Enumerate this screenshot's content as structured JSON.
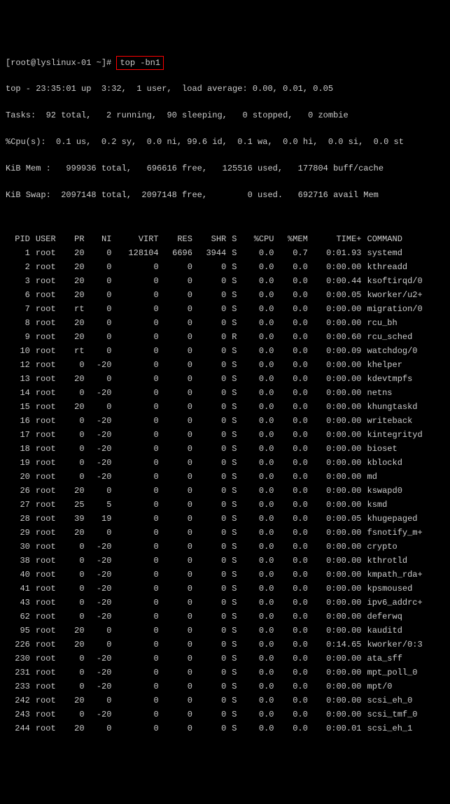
{
  "prompt": {
    "userhost": "[root@lyslinux-01 ~]#",
    "command": "top -bn1"
  },
  "summary": {
    "line1": "top - 23:35:01 up  3:32,  1 user,  load average: 0.00, 0.01, 0.05",
    "line2": "Tasks:  92 total,   2 running,  90 sleeping,   0 stopped,   0 zombie",
    "line3": "%Cpu(s):  0.1 us,  0.2 sy,  0.0 ni, 99.6 id,  0.1 wa,  0.0 hi,  0.0 si,  0.0 st",
    "line4": "KiB Mem :   999936 total,   696616 free,   125516 used,   177804 buff/cache",
    "line5": "KiB Swap:  2097148 total,  2097148 free,        0 used.   692716 avail Mem"
  },
  "columns": [
    "PID",
    "USER",
    "PR",
    "NI",
    "VIRT",
    "RES",
    "SHR",
    "S",
    "%CPU",
    "%MEM",
    "TIME+",
    "COMMAND"
  ],
  "rows": [
    {
      "pid": "1",
      "user": "root",
      "pr": "20",
      "ni": "0",
      "virt": "128104",
      "res": "6696",
      "shr": "3944",
      "s": "S",
      "cpu": "0.0",
      "mem": "0.7",
      "time": "0:01.93",
      "cmd": "systemd"
    },
    {
      "pid": "2",
      "user": "root",
      "pr": "20",
      "ni": "0",
      "virt": "0",
      "res": "0",
      "shr": "0",
      "s": "S",
      "cpu": "0.0",
      "mem": "0.0",
      "time": "0:00.00",
      "cmd": "kthreadd"
    },
    {
      "pid": "3",
      "user": "root",
      "pr": "20",
      "ni": "0",
      "virt": "0",
      "res": "0",
      "shr": "0",
      "s": "S",
      "cpu": "0.0",
      "mem": "0.0",
      "time": "0:00.44",
      "cmd": "ksoftirqd/0"
    },
    {
      "pid": "6",
      "user": "root",
      "pr": "20",
      "ni": "0",
      "virt": "0",
      "res": "0",
      "shr": "0",
      "s": "S",
      "cpu": "0.0",
      "mem": "0.0",
      "time": "0:00.05",
      "cmd": "kworker/u2+"
    },
    {
      "pid": "7",
      "user": "root",
      "pr": "rt",
      "ni": "0",
      "virt": "0",
      "res": "0",
      "shr": "0",
      "s": "S",
      "cpu": "0.0",
      "mem": "0.0",
      "time": "0:00.00",
      "cmd": "migration/0"
    },
    {
      "pid": "8",
      "user": "root",
      "pr": "20",
      "ni": "0",
      "virt": "0",
      "res": "0",
      "shr": "0",
      "s": "S",
      "cpu": "0.0",
      "mem": "0.0",
      "time": "0:00.00",
      "cmd": "rcu_bh"
    },
    {
      "pid": "9",
      "user": "root",
      "pr": "20",
      "ni": "0",
      "virt": "0",
      "res": "0",
      "shr": "0",
      "s": "R",
      "cpu": "0.0",
      "mem": "0.0",
      "time": "0:00.60",
      "cmd": "rcu_sched"
    },
    {
      "pid": "10",
      "user": "root",
      "pr": "rt",
      "ni": "0",
      "virt": "0",
      "res": "0",
      "shr": "0",
      "s": "S",
      "cpu": "0.0",
      "mem": "0.0",
      "time": "0:00.09",
      "cmd": "watchdog/0"
    },
    {
      "pid": "12",
      "user": "root",
      "pr": "0",
      "ni": "-20",
      "virt": "0",
      "res": "0",
      "shr": "0",
      "s": "S",
      "cpu": "0.0",
      "mem": "0.0",
      "time": "0:00.00",
      "cmd": "khelper"
    },
    {
      "pid": "13",
      "user": "root",
      "pr": "20",
      "ni": "0",
      "virt": "0",
      "res": "0",
      "shr": "0",
      "s": "S",
      "cpu": "0.0",
      "mem": "0.0",
      "time": "0:00.00",
      "cmd": "kdevtmpfs"
    },
    {
      "pid": "14",
      "user": "root",
      "pr": "0",
      "ni": "-20",
      "virt": "0",
      "res": "0",
      "shr": "0",
      "s": "S",
      "cpu": "0.0",
      "mem": "0.0",
      "time": "0:00.00",
      "cmd": "netns"
    },
    {
      "pid": "15",
      "user": "root",
      "pr": "20",
      "ni": "0",
      "virt": "0",
      "res": "0",
      "shr": "0",
      "s": "S",
      "cpu": "0.0",
      "mem": "0.0",
      "time": "0:00.00",
      "cmd": "khungtaskd"
    },
    {
      "pid": "16",
      "user": "root",
      "pr": "0",
      "ni": "-20",
      "virt": "0",
      "res": "0",
      "shr": "0",
      "s": "S",
      "cpu": "0.0",
      "mem": "0.0",
      "time": "0:00.00",
      "cmd": "writeback"
    },
    {
      "pid": "17",
      "user": "root",
      "pr": "0",
      "ni": "-20",
      "virt": "0",
      "res": "0",
      "shr": "0",
      "s": "S",
      "cpu": "0.0",
      "mem": "0.0",
      "time": "0:00.00",
      "cmd": "kintegrityd"
    },
    {
      "pid": "18",
      "user": "root",
      "pr": "0",
      "ni": "-20",
      "virt": "0",
      "res": "0",
      "shr": "0",
      "s": "S",
      "cpu": "0.0",
      "mem": "0.0",
      "time": "0:00.00",
      "cmd": "bioset"
    },
    {
      "pid": "19",
      "user": "root",
      "pr": "0",
      "ni": "-20",
      "virt": "0",
      "res": "0",
      "shr": "0",
      "s": "S",
      "cpu": "0.0",
      "mem": "0.0",
      "time": "0:00.00",
      "cmd": "kblockd"
    },
    {
      "pid": "20",
      "user": "root",
      "pr": "0",
      "ni": "-20",
      "virt": "0",
      "res": "0",
      "shr": "0",
      "s": "S",
      "cpu": "0.0",
      "mem": "0.0",
      "time": "0:00.00",
      "cmd": "md"
    },
    {
      "pid": "26",
      "user": "root",
      "pr": "20",
      "ni": "0",
      "virt": "0",
      "res": "0",
      "shr": "0",
      "s": "S",
      "cpu": "0.0",
      "mem": "0.0",
      "time": "0:00.00",
      "cmd": "kswapd0"
    },
    {
      "pid": "27",
      "user": "root",
      "pr": "25",
      "ni": "5",
      "virt": "0",
      "res": "0",
      "shr": "0",
      "s": "S",
      "cpu": "0.0",
      "mem": "0.0",
      "time": "0:00.00",
      "cmd": "ksmd"
    },
    {
      "pid": "28",
      "user": "root",
      "pr": "39",
      "ni": "19",
      "virt": "0",
      "res": "0",
      "shr": "0",
      "s": "S",
      "cpu": "0.0",
      "mem": "0.0",
      "time": "0:00.05",
      "cmd": "khugepaged"
    },
    {
      "pid": "29",
      "user": "root",
      "pr": "20",
      "ni": "0",
      "virt": "0",
      "res": "0",
      "shr": "0",
      "s": "S",
      "cpu": "0.0",
      "mem": "0.0",
      "time": "0:00.00",
      "cmd": "fsnotify_m+"
    },
    {
      "pid": "30",
      "user": "root",
      "pr": "0",
      "ni": "-20",
      "virt": "0",
      "res": "0",
      "shr": "0",
      "s": "S",
      "cpu": "0.0",
      "mem": "0.0",
      "time": "0:00.00",
      "cmd": "crypto"
    },
    {
      "pid": "38",
      "user": "root",
      "pr": "0",
      "ni": "-20",
      "virt": "0",
      "res": "0",
      "shr": "0",
      "s": "S",
      "cpu": "0.0",
      "mem": "0.0",
      "time": "0:00.00",
      "cmd": "kthrotld"
    },
    {
      "pid": "40",
      "user": "root",
      "pr": "0",
      "ni": "-20",
      "virt": "0",
      "res": "0",
      "shr": "0",
      "s": "S",
      "cpu": "0.0",
      "mem": "0.0",
      "time": "0:00.00",
      "cmd": "kmpath_rda+"
    },
    {
      "pid": "41",
      "user": "root",
      "pr": "0",
      "ni": "-20",
      "virt": "0",
      "res": "0",
      "shr": "0",
      "s": "S",
      "cpu": "0.0",
      "mem": "0.0",
      "time": "0:00.00",
      "cmd": "kpsmoused"
    },
    {
      "pid": "43",
      "user": "root",
      "pr": "0",
      "ni": "-20",
      "virt": "0",
      "res": "0",
      "shr": "0",
      "s": "S",
      "cpu": "0.0",
      "mem": "0.0",
      "time": "0:00.00",
      "cmd": "ipv6_addrc+"
    },
    {
      "pid": "62",
      "user": "root",
      "pr": "0",
      "ni": "-20",
      "virt": "0",
      "res": "0",
      "shr": "0",
      "s": "S",
      "cpu": "0.0",
      "mem": "0.0",
      "time": "0:00.00",
      "cmd": "deferwq"
    },
    {
      "pid": "95",
      "user": "root",
      "pr": "20",
      "ni": "0",
      "virt": "0",
      "res": "0",
      "shr": "0",
      "s": "S",
      "cpu": "0.0",
      "mem": "0.0",
      "time": "0:00.00",
      "cmd": "kauditd"
    },
    {
      "pid": "226",
      "user": "root",
      "pr": "20",
      "ni": "0",
      "virt": "0",
      "res": "0",
      "shr": "0",
      "s": "S",
      "cpu": "0.0",
      "mem": "0.0",
      "time": "0:14.65",
      "cmd": "kworker/0:3"
    },
    {
      "pid": "230",
      "user": "root",
      "pr": "0",
      "ni": "-20",
      "virt": "0",
      "res": "0",
      "shr": "0",
      "s": "S",
      "cpu": "0.0",
      "mem": "0.0",
      "time": "0:00.00",
      "cmd": "ata_sff"
    },
    {
      "pid": "231",
      "user": "root",
      "pr": "0",
      "ni": "-20",
      "virt": "0",
      "res": "0",
      "shr": "0",
      "s": "S",
      "cpu": "0.0",
      "mem": "0.0",
      "time": "0:00.00",
      "cmd": "mpt_poll_0"
    },
    {
      "pid": "233",
      "user": "root",
      "pr": "0",
      "ni": "-20",
      "virt": "0",
      "res": "0",
      "shr": "0",
      "s": "S",
      "cpu": "0.0",
      "mem": "0.0",
      "time": "0:00.00",
      "cmd": "mpt/0"
    },
    {
      "pid": "242",
      "user": "root",
      "pr": "20",
      "ni": "0",
      "virt": "0",
      "res": "0",
      "shr": "0",
      "s": "S",
      "cpu": "0.0",
      "mem": "0.0",
      "time": "0:00.00",
      "cmd": "scsi_eh_0"
    },
    {
      "pid": "243",
      "user": "root",
      "pr": "0",
      "ni": "-20",
      "virt": "0",
      "res": "0",
      "shr": "0",
      "s": "S",
      "cpu": "0.0",
      "mem": "0.0",
      "time": "0:00.00",
      "cmd": "scsi_tmf_0"
    },
    {
      "pid": "244",
      "user": "root",
      "pr": "20",
      "ni": "0",
      "virt": "0",
      "res": "0",
      "shr": "0",
      "s": "S",
      "cpu": "0.0",
      "mem": "0.0",
      "time": "0:00.01",
      "cmd": "scsi_eh_1"
    }
  ]
}
